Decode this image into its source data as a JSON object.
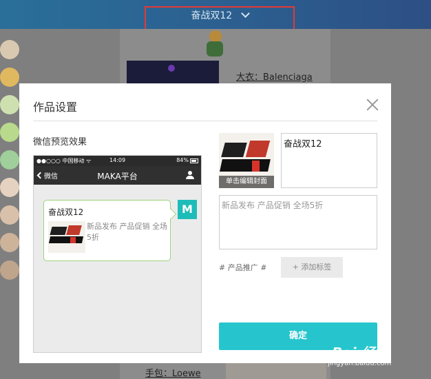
{
  "background": {
    "header_title": "奋战双12",
    "product_labels": [
      "大衣：Balenciaga",
      "手包：Loewe"
    ]
  },
  "modal": {
    "title": "作品设置",
    "close_icon": "close-icon",
    "preview_label": "微信预览效果",
    "phone": {
      "carrier": "●●○○○ 中国移动 ᯤ",
      "time": "14:09",
      "battery": "84%",
      "back_label": "微信",
      "nav_title": "MAKA平台",
      "avatar_letter": "M",
      "card_title": "奋战双12",
      "card_desc": "新品发布 产品促销 全场5折"
    },
    "cover_label": "单击编辑封面",
    "title_value": "奋战双12",
    "desc_value": "新品发布 产品促销 全场5折",
    "tag_text": "# 产品推广 #",
    "add_tag_label": "+ 添加标签",
    "confirm_label": "确定"
  },
  "watermark": {
    "main": "Bai 经验",
    "sub": "jingyan.baidu.com"
  },
  "colors": {
    "accent": "#26c5cd",
    "header": "#2c5d8f",
    "highlight_box": "#e53935",
    "avatar": "#1dbcb9"
  }
}
